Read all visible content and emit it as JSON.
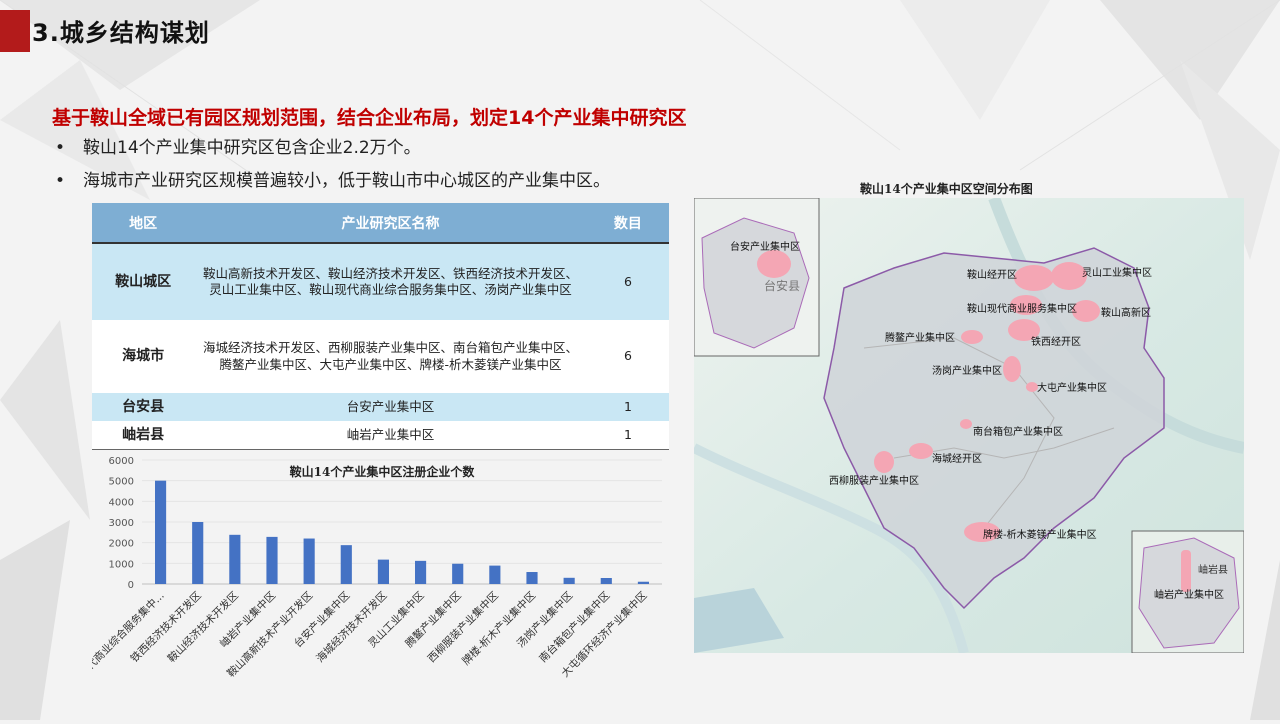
{
  "page": {
    "title": "3.城乡结构谋划",
    "headline": "基于鞍山全域已有园区规划范围，结合企业布局，划定14个产业集中研究区",
    "bullets": [
      "鞍山14个产业集中研究区包含企业2.2万个。",
      "海城市产业研究区规模普遍较小，低于鞍山市中心城区的产业集中区。"
    ]
  },
  "table": {
    "headers": [
      "地区",
      "产业研究区名称",
      "数目"
    ],
    "rows": [
      {
        "region": "鞍山城区",
        "names": "鞍山高新技术开发区、鞍山经济技术开发区、铁西经济技术开发区、灵山工业集中区、鞍山现代商业综合服务集中区、汤岗产业集中区",
        "count": "6"
      },
      {
        "region": "海城市",
        "names": "海城经济技术开发区、西柳服装产业集中区、南台箱包产业集中区、腾鳌产业集中区、大屯产业集中区、牌楼-析木菱镁产业集中区",
        "count": "6"
      },
      {
        "region": "台安县",
        "names": "台安产业集中区",
        "count": "1"
      },
      {
        "region": "岫岩县",
        "names": "岫岩产业集中区",
        "count": "1"
      }
    ]
  },
  "chart_data": {
    "type": "bar",
    "title": "鞍山14个产业集中区注册企业个数",
    "categories": [
      "鞍山现代商业综合服务集中...",
      "铁西经济技术开发区",
      "鞍山经济技术开发区",
      "岫岩产业集中区",
      "鞍山高新技术产业开发区",
      "台安产业集中区",
      "海城经济技术开发区",
      "灵山工业集中区",
      "腾鳌产业集中区",
      "西柳服装产业集中区",
      "牌楼-析木产业集中区",
      "汤岗产业集中区",
      "南台箱包产业集中区",
      "大屯循环经济产业集中区"
    ],
    "values": [
      5000,
      3000,
      2380,
      2280,
      2200,
      1880,
      1180,
      1120,
      980,
      890,
      580,
      300,
      290,
      110
    ],
    "yticks": [
      "0",
      "1000",
      "2000",
      "3000",
      "4000",
      "5000",
      "6000"
    ],
    "ylim": [
      0,
      6000
    ],
    "bar_color": "#4472c4"
  },
  "map": {
    "title": "鞍山14个产业集中区空间分布图",
    "inset_tl_county": "台安县",
    "inset_br_county": "岫岩县",
    "labels": [
      "台安产业集中区",
      "鞍山经开区",
      "灵山工业集中区",
      "鞍山现代商业服务集中区",
      "鞍山高新区",
      "腾鳌产业集中区",
      "铁西经开区",
      "汤岗产业集中区",
      "大屯产业集中区",
      "南台箱包产业集中区",
      "海城经开区",
      "西柳服装产业集中区",
      "牌楼-析木菱镁产业集中区",
      "岫岩产业集中区"
    ]
  }
}
